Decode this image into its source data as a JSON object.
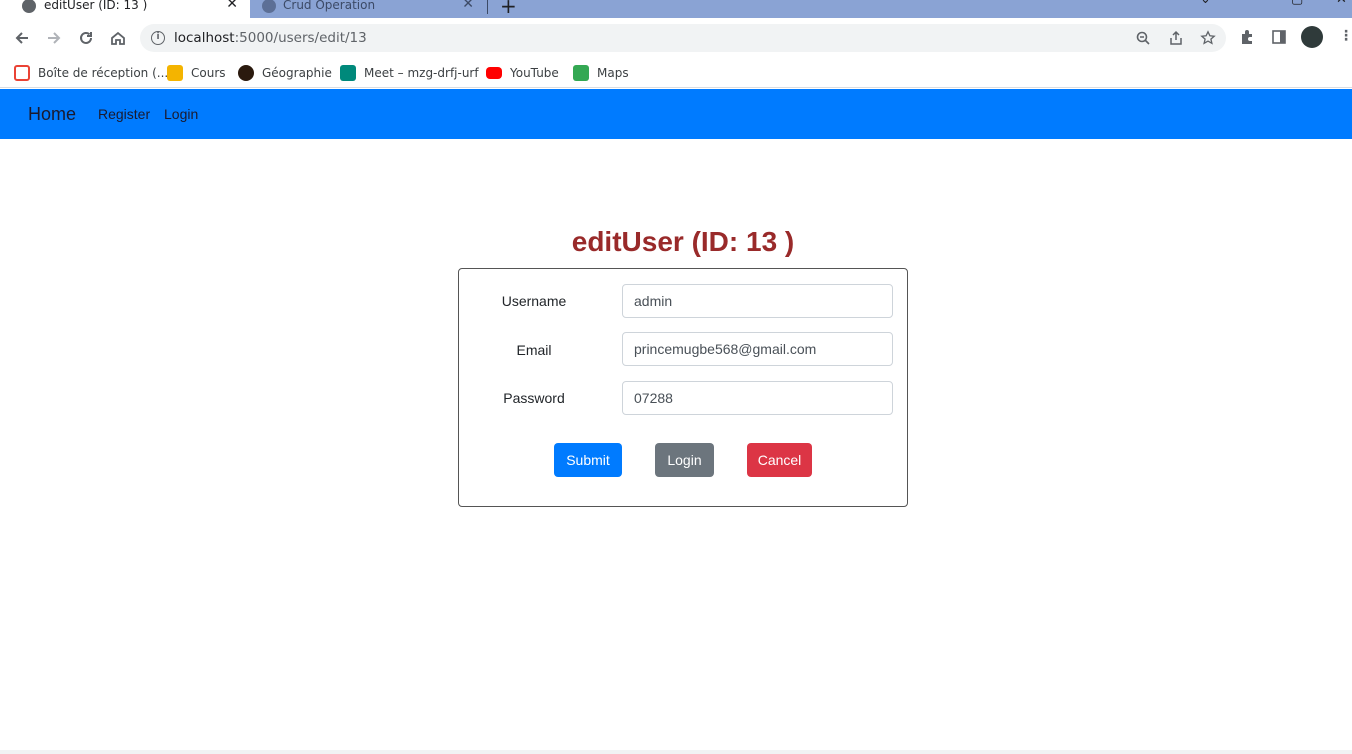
{
  "browser": {
    "tabs": [
      {
        "title": "editUser (ID: 13 )",
        "active": true,
        "close": "✕"
      },
      {
        "title": "Crud Operation",
        "active": false,
        "close": "✕"
      }
    ],
    "new_tab": "+",
    "url_host": "localhost",
    "url_path": ":5000/users/edit/13",
    "bookmarks": [
      {
        "label": "Boîte de réception (...",
        "icon": "gmail-icon",
        "color": "#ea4335"
      },
      {
        "label": "Cours",
        "icon": "classroom-icon",
        "color": "#f4b400"
      },
      {
        "label": "Géographie",
        "icon": "avatar-icon",
        "color": "#2b1a0e"
      },
      {
        "label": "Meet – mzg-drfj-urf",
        "icon": "meet-icon",
        "color": "#00897b"
      },
      {
        "label": "YouTube",
        "icon": "youtube-icon",
        "color": "#ff0000"
      },
      {
        "label": "Maps",
        "icon": "maps-icon",
        "color": "#34a853"
      }
    ]
  },
  "nav": {
    "brand": "Home",
    "links": [
      "Register",
      "Login"
    ],
    "background": "#007bff"
  },
  "form": {
    "title": "editUser (ID: 13 )",
    "title_color": "#992a2a",
    "fields": [
      {
        "label": "Username",
        "value": "admin"
      },
      {
        "label": "Email",
        "value": "princemugbe568@gmail.com"
      },
      {
        "label": "Password",
        "value": "07288"
      }
    ],
    "buttons": {
      "submit": "Submit",
      "login": "Login",
      "cancel": "Cancel"
    }
  }
}
